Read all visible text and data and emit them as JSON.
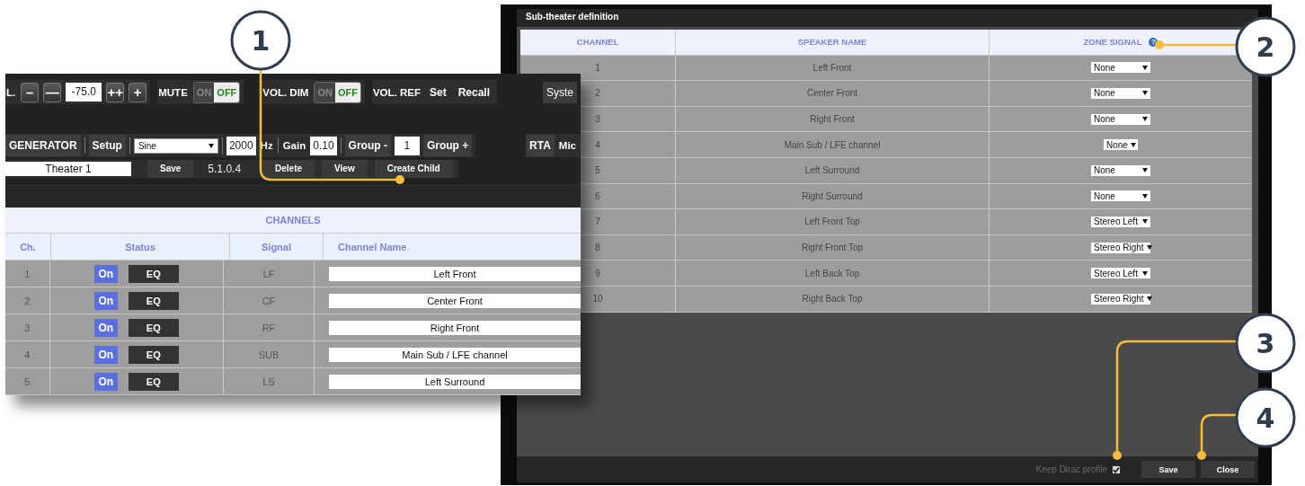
{
  "main_window": {
    "toolbar_rows": [
      {
        "groups": [
          {
            "items": [
              {
                "kind": "label",
                "text": "L."
              },
              {
                "kind": "button",
                "text": "–"
              },
              {
                "kind": "button",
                "text": "—"
              },
              {
                "kind": "input",
                "value": "-75.0"
              },
              {
                "kind": "button",
                "text": "++"
              },
              {
                "kind": "button",
                "text": "+"
              }
            ]
          },
          {
            "items": [
              {
                "kind": "label",
                "text": "MUTE"
              },
              {
                "kind": "toggle",
                "on_label": "ON",
                "off_label": "OFF",
                "on": false
              }
            ]
          },
          {
            "items": [
              {
                "kind": "label",
                "text": "VOL. DIM"
              },
              {
                "kind": "toggle",
                "on_label": "ON",
                "off_label": "OFF",
                "on": false
              }
            ]
          },
          {
            "items": [
              {
                "kind": "label",
                "text": "VOL. REF"
              },
              {
                "kind": "flat",
                "text": "Set"
              },
              {
                "kind": "flat",
                "text": "Recall"
              }
            ]
          },
          {
            "items": [
              {
                "kind": "flat",
                "text": "Syste"
              }
            ]
          }
        ]
      },
      {
        "groups": [
          {
            "items": [
              {
                "kind": "flat",
                "text": "GENERATOR"
              },
              {
                "kind": "sep"
              },
              {
                "kind": "flat",
                "text": "Setup"
              },
              {
                "kind": "sep"
              },
              {
                "kind": "select",
                "value": "Sine"
              },
              {
                "kind": "sep"
              },
              {
                "kind": "input",
                "value": "2000"
              },
              {
                "kind": "label",
                "text": "Hz"
              },
              {
                "kind": "sep"
              },
              {
                "kind": "label",
                "text": "Gain"
              },
              {
                "kind": "input",
                "value": "0.10"
              },
              {
                "kind": "sep"
              },
              {
                "kind": "flat",
                "text": "Group -"
              },
              {
                "kind": "input",
                "value": "1"
              },
              {
                "kind": "flat",
                "text": "Group +"
              }
            ]
          },
          {
            "items": [
              {
                "kind": "flat",
                "text": "RTA"
              },
              {
                "kind": "label",
                "text": "Mic"
              }
            ]
          }
        ]
      },
      {
        "groups": [
          {
            "items": [
              {
                "kind": "name",
                "value": "Theater 1"
              },
              {
                "kind": "small",
                "text": "Save"
              },
              {
                "kind": "version",
                "text": "5.1.0.4"
              },
              {
                "kind": "small",
                "text": "Delete"
              },
              {
                "kind": "small",
                "text": "View"
              },
              {
                "kind": "small",
                "text": "Create Child"
              }
            ]
          }
        ]
      }
    ],
    "channels": {
      "title": "CHANNELS",
      "columns": [
        "Ch.",
        "Status",
        "Signal",
        "Channel Name"
      ],
      "rows": [
        {
          "ch": "1",
          "status": "On",
          "on": true,
          "eq": "EQ",
          "signal": "LF",
          "name": "Left Front"
        },
        {
          "ch": "2",
          "status": "On",
          "on": true,
          "eq": "EQ",
          "signal": "CF",
          "name": "Center Front"
        },
        {
          "ch": "3",
          "status": "On",
          "on": true,
          "eq": "EQ",
          "signal": "RF",
          "name": "Right Front"
        },
        {
          "ch": "4",
          "status": "On",
          "on": true,
          "eq": "EQ",
          "signal": "SUB",
          "name": "Main Sub / LFE channel"
        },
        {
          "ch": "5",
          "status": "On",
          "on": true,
          "eq": "EQ",
          "signal": "LS",
          "name": "Left Surround"
        }
      ]
    }
  },
  "dialog": {
    "title": "Sub-theater definition",
    "columns": [
      "CHANNEL",
      "SPEAKER NAME",
      "ZONE SIGNAL"
    ],
    "help": "?",
    "rows": [
      {
        "channel": "1",
        "speaker": "Left Front",
        "zone": "None",
        "compact": false
      },
      {
        "channel": "2",
        "speaker": "Center Front",
        "zone": "None",
        "compact": false
      },
      {
        "channel": "3",
        "speaker": "Right Front",
        "zone": "None",
        "compact": false
      },
      {
        "channel": "4",
        "speaker": "Main Sub / LFE channel",
        "zone": "None",
        "compact": true
      },
      {
        "channel": "5",
        "speaker": "Left Surround",
        "zone": "None",
        "compact": false
      },
      {
        "channel": "6",
        "speaker": "Right Surround",
        "zone": "None",
        "compact": false
      },
      {
        "channel": "7",
        "speaker": "Left Front Top",
        "zone": "Stereo Left",
        "compact": false
      },
      {
        "channel": "8",
        "speaker": "Right Front Top",
        "zone": "Stereo Right",
        "compact": false
      },
      {
        "channel": "9",
        "speaker": "Left Back Top",
        "zone": "Stereo Left",
        "compact": false
      },
      {
        "channel": "10",
        "speaker": "Right Back Top",
        "zone": "Stereo Right",
        "compact": false
      }
    ],
    "keep_profile": {
      "label": "Keep Dirac profile",
      "checked": true
    },
    "buttons": [
      "Save",
      "Close"
    ]
  },
  "callouts": [
    {
      "number": "1"
    },
    {
      "number": "2"
    },
    {
      "number": "3"
    },
    {
      "number": "4"
    }
  ]
}
